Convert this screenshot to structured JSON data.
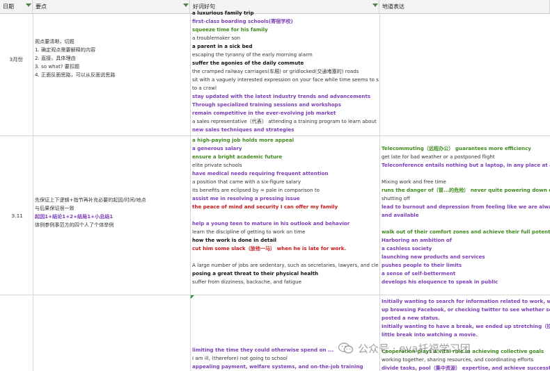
{
  "header": {
    "col_date": "日期",
    "col_topic": "要点",
    "col_phrases": "好词好句",
    "col_expressions": "地道表达"
  },
  "rows": [
    {
      "date": "3月份",
      "notes": [
        {
          "t": "观点要清晰，切题",
          "c": "n"
        },
        {
          "t": "1. 确定观点需要解释的内容",
          "c": "n"
        },
        {
          "t": "2. 直接，具体理由",
          "c": "n"
        },
        {
          "t": "3. so what? 要扣题",
          "c": "n"
        },
        {
          "t": "4. 正面反面思路，可以从反面说思路",
          "c": "n"
        }
      ],
      "phrases": [
        {
          "t": "a luxurious family trip",
          "c": "k"
        },
        {
          "t": "first-class boarding schools(寄宿学校)",
          "c": "p"
        },
        {
          "t": "squeeze time for his family",
          "c": "g"
        },
        {
          "t": "a troublemaker son",
          "c": "n"
        },
        {
          "t": "a parent in a sick bed",
          "c": "k"
        },
        {
          "t": "escaping the tyranny of the early morning alarm",
          "c": "n"
        },
        {
          "t": "suffer the agonies of the daily commute",
          "c": "k"
        },
        {
          "t": "the cramped railway carriages(车厢) or gridlocked(交通堵塞的) roads",
          "c": "n"
        },
        {
          "t": "sit with a vaguely interested expression on your face while time seems to slow",
          "c": "n"
        },
        {
          "t": "to a crawl",
          "c": "n"
        },
        {
          "t": "stay updated with the latest industry trends and advancements",
          "c": "p"
        },
        {
          "t": "Through specialized training sessions and workshops",
          "c": "p"
        },
        {
          "t": "remain competitive in the ever-evolving job market",
          "c": "p"
        },
        {
          "t": "a sales representative（代表） attending a training program to learn about",
          "c": "n"
        },
        {
          "t": "new sales techniques and strategies",
          "c": "p"
        }
      ],
      "expressions": []
    },
    {
      "date": "3.11",
      "notes": [
        {
          "t": "先保证上下逻辑+指节再补充必要的起因/时间/地点",
          "c": "n"
        },
        {
          "t": "与后果保证很一致",
          "c": "n"
        },
        {
          "t": "起因1+结论1+2+结局1+小总结1",
          "c": "p"
        },
        {
          "t": "体例参例事范方的四个人了个体举例",
          "c": "n"
        }
      ],
      "phrases": [
        {
          "t": "a high-paying job holds more appeal",
          "c": "g"
        },
        {
          "t": "a generous salary",
          "c": "p"
        },
        {
          "t": "ensure a bright academic future",
          "c": "g"
        },
        {
          "t": "elite private schools",
          "c": "n"
        },
        {
          "t": "have medical needs requiring frequent attention",
          "c": "p"
        },
        {
          "t": "a position that came with a six-figure salary",
          "c": "n"
        },
        {
          "t": "its benefits are eclipsed by = pale in comparison to",
          "c": "n"
        },
        {
          "t": "assist me in resolving a pressing issue",
          "c": "p"
        },
        {
          "t": "the peace of mind and security I can offer my family",
          "c": "r"
        },
        {
          "t": "",
          "c": "n"
        },
        {
          "t": "help a young teen to mature in his outlook and behavior",
          "c": "p"
        },
        {
          "t": "learn the discipline of getting to work on time",
          "c": "n"
        },
        {
          "t": "how the work is done in detail",
          "c": "k"
        },
        {
          "t": "cut him some slack（放他一马） when he is late for work.",
          "c": "r"
        },
        {
          "t": "",
          "c": "n"
        },
        {
          "t": "A large number of jobs are sedentary, such as secretaries, lawyers, and clerks",
          "c": "n"
        },
        {
          "t": "posing a great threat to their physical health",
          "c": "k"
        },
        {
          "t": "suffer from dizziness, backache, and fatigue",
          "c": "n"
        }
      ],
      "expressions": [
        {
          "t": "Telecommuting（远程办公） guarantees more efficiency",
          "c": "g"
        },
        {
          "t": "get late for bad weather or a postponed flight",
          "c": "n"
        },
        {
          "t": "Teleconference entails nothing but a laptop, in any place at any tim",
          "c": "p"
        },
        {
          "t": "",
          "c": "n"
        },
        {
          "t": "Mixing work and free time",
          "c": "n"
        },
        {
          "t": "runs the danger of（冒...的危险） never quite powering down or",
          "c": "g"
        },
        {
          "t": "shutting off",
          "c": "n"
        },
        {
          "t": "lead to burnout and depression from feeling like we are always on",
          "c": "p"
        },
        {
          "t": "and available",
          "c": "p"
        },
        {
          "t": "",
          "c": "n"
        },
        {
          "t": "walk out of their comfort zones and achieve their full potential",
          "c": "g"
        },
        {
          "t": "Harboring an ambition of",
          "c": "p"
        },
        {
          "t": "a cashless society",
          "c": "p"
        },
        {
          "t": "launching new products and services",
          "c": "p"
        },
        {
          "t": "pushes people to their limits",
          "c": "p"
        },
        {
          "t": "a sense of self-betterment",
          "c": "p"
        },
        {
          "t": "develops his eloquence to speak in public",
          "c": "p"
        }
      ]
    },
    {
      "date": "",
      "notes": [],
      "phrases": [
        {
          "t": "limiting the time they could otherwise spend on ...",
          "c": "p"
        },
        {
          "t": "I am ill, (therefore) not going to school",
          "c": "n"
        },
        {
          "t": "appealing payment, welfare systems, and on-the-job training",
          "c": "p"
        }
      ],
      "expressions": [
        {
          "t": "Initially wanting to search for information related to work, we ende",
          "c": "p"
        },
        {
          "t": "up browsing Facebook, or checking twitter to see whether someon",
          "c": "p"
        },
        {
          "t": "posted a new status.",
          "c": "p"
        },
        {
          "t": "Initially wanting to have a break, we ended up stretching（拉长） th",
          "c": "p"
        },
        {
          "t": "little break into watching a movie.",
          "c": "p"
        },
        {
          "t": "",
          "c": "n"
        },
        {
          "t": "Cooperation plays a vital role in achieving collective goals",
          "c": "g"
        },
        {
          "t": "working together, sharing resources, and coordinating efforts",
          "c": "n"
        },
        {
          "t": "divide tasks, pool（集中资源） expertise, and achieve successful",
          "c": "p"
        }
      ]
    }
  ],
  "watermark": {
    "text": "公众号 · eva托福学习团",
    "icon": "wechat-icon"
  },
  "colors": {
    "purple": "#7b3fb8",
    "green": "#3f8a1e",
    "red": "#c71a1a",
    "filter": "#4a8a3c"
  }
}
